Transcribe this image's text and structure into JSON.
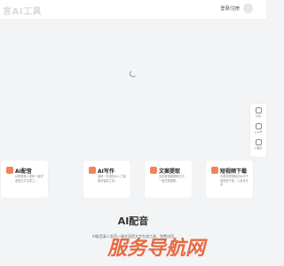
{
  "header": {
    "logo_text": "言AI工具",
    "login_label": "登录/注册"
  },
  "side_rail": [
    {
      "icon": "share-icon",
      "label": "分享"
    },
    {
      "icon": "wechat-icon",
      "label": "公众号"
    },
    {
      "icon": "miniprogram-icon",
      "label": "小程序"
    }
  ],
  "cards": [
    {
      "icon": "microphone-icon",
      "title": "AI配音",
      "desc": "AI配音真人发声一键式语音文字生成工…",
      "color": "#f0845b"
    },
    {
      "icon": "pen-icon",
      "title": "AI写作",
      "desc": "最新一代语言AI人工智能的智能工具。",
      "color": "#f0845b"
    },
    {
      "icon": "text-extract-icon",
      "title": "文案提取",
      "desc": "支持音视频提取文字，一键文案提取。",
      "color": "#f0845b"
    },
    {
      "icon": "download-icon",
      "title": "短视频下载",
      "desc": "可提供短视频无水印下载视频下载，以及多平台",
      "color": "#f0845b"
    }
  ],
  "section": {
    "title": "AI配音",
    "subtitle": "AI配音真人发声一键式语音文字生成工具，免费试用"
  },
  "watermark": "服务导航网"
}
